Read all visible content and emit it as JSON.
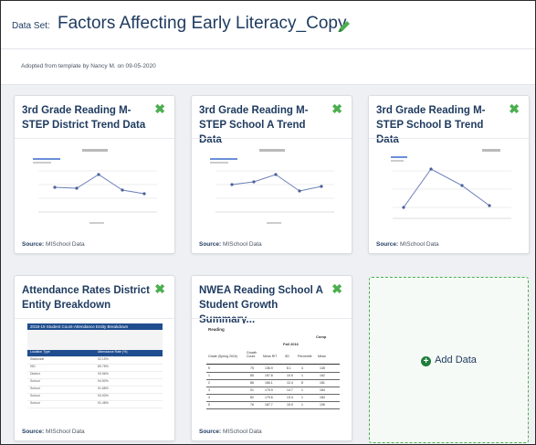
{
  "header": {
    "dataset_label": "Data Set:",
    "dataset_title": "Factors Affecting Early Literacy_Copy"
  },
  "subheader": {
    "adopted_text": "Adopted from template by Nancy M. on 09-05-2020"
  },
  "cards": [
    {
      "title": "3rd Grade Reading M-STEP District Trend Data",
      "source_label": "Source:",
      "source_value": "MISchool Data"
    },
    {
      "title": "3rd Grade Reading M-STEP School A Trend Data",
      "source_label": "Source:",
      "source_value": "MISchool Data"
    },
    {
      "title": "3rd Grade Reading M-STEP School B Trend Data",
      "source_label": "Source:",
      "source_value": "MISchool Data"
    },
    {
      "title": "Attendance Rates District Entity Breakdown",
      "source_label": "Source:",
      "source_value": "MISchool Data"
    },
    {
      "title": "NWEA Reading School A Student Growth Summary...",
      "source_label": "Source:",
      "source_value": "MISchool Data"
    }
  ],
  "add_card": {
    "label": "Add Data"
  },
  "thumb_attendance": {
    "banner": "2018-19 Student Count-Attendance Entity Breakdown",
    "col1": "Location Type",
    "col2": "Attendance Rate (%)",
    "rows": [
      [
        "Statewide",
        "92.15%"
      ],
      [
        "ISD",
        "89.78%"
      ],
      [
        "District",
        "93.56%"
      ],
      [
        "School",
        "94.50%"
      ],
      [
        "School",
        "91.68%"
      ],
      [
        "School",
        "93.93%"
      ],
      [
        "School",
        "91.48%"
      ]
    ]
  },
  "thumb_nwea": {
    "title": "Reading",
    "group_label": "Comp",
    "term": "Fall 2016",
    "col_grade": "Grade (Spring 2016)",
    "col_growth": "Growth Count",
    "col_mean": "Mean RIT",
    "col_sd": "SD",
    "col_pct": "Percentile",
    "col_mean2": "Mean",
    "rows": [
      [
        "K",
        "75",
        "136.9",
        "8.1",
        "4",
        "145"
      ],
      [
        "1",
        "85",
        "157.8",
        "10.5",
        "1",
        "162"
      ],
      [
        "2",
        "86",
        "166.1",
        "12.4",
        "8",
        "181"
      ],
      [
        "3",
        "91",
        "179.9",
        "14.7",
        "1",
        "184"
      ],
      [
        "4",
        "82",
        "179.6",
        "13.4",
        "1",
        "184"
      ],
      [
        "5",
        "76",
        "187.7",
        "15.9",
        "1",
        "195"
      ]
    ]
  },
  "colors": {
    "accent_green": "#4caf50",
    "title_navy": "#1e3a5f",
    "table_blue": "#1f4d8f"
  }
}
